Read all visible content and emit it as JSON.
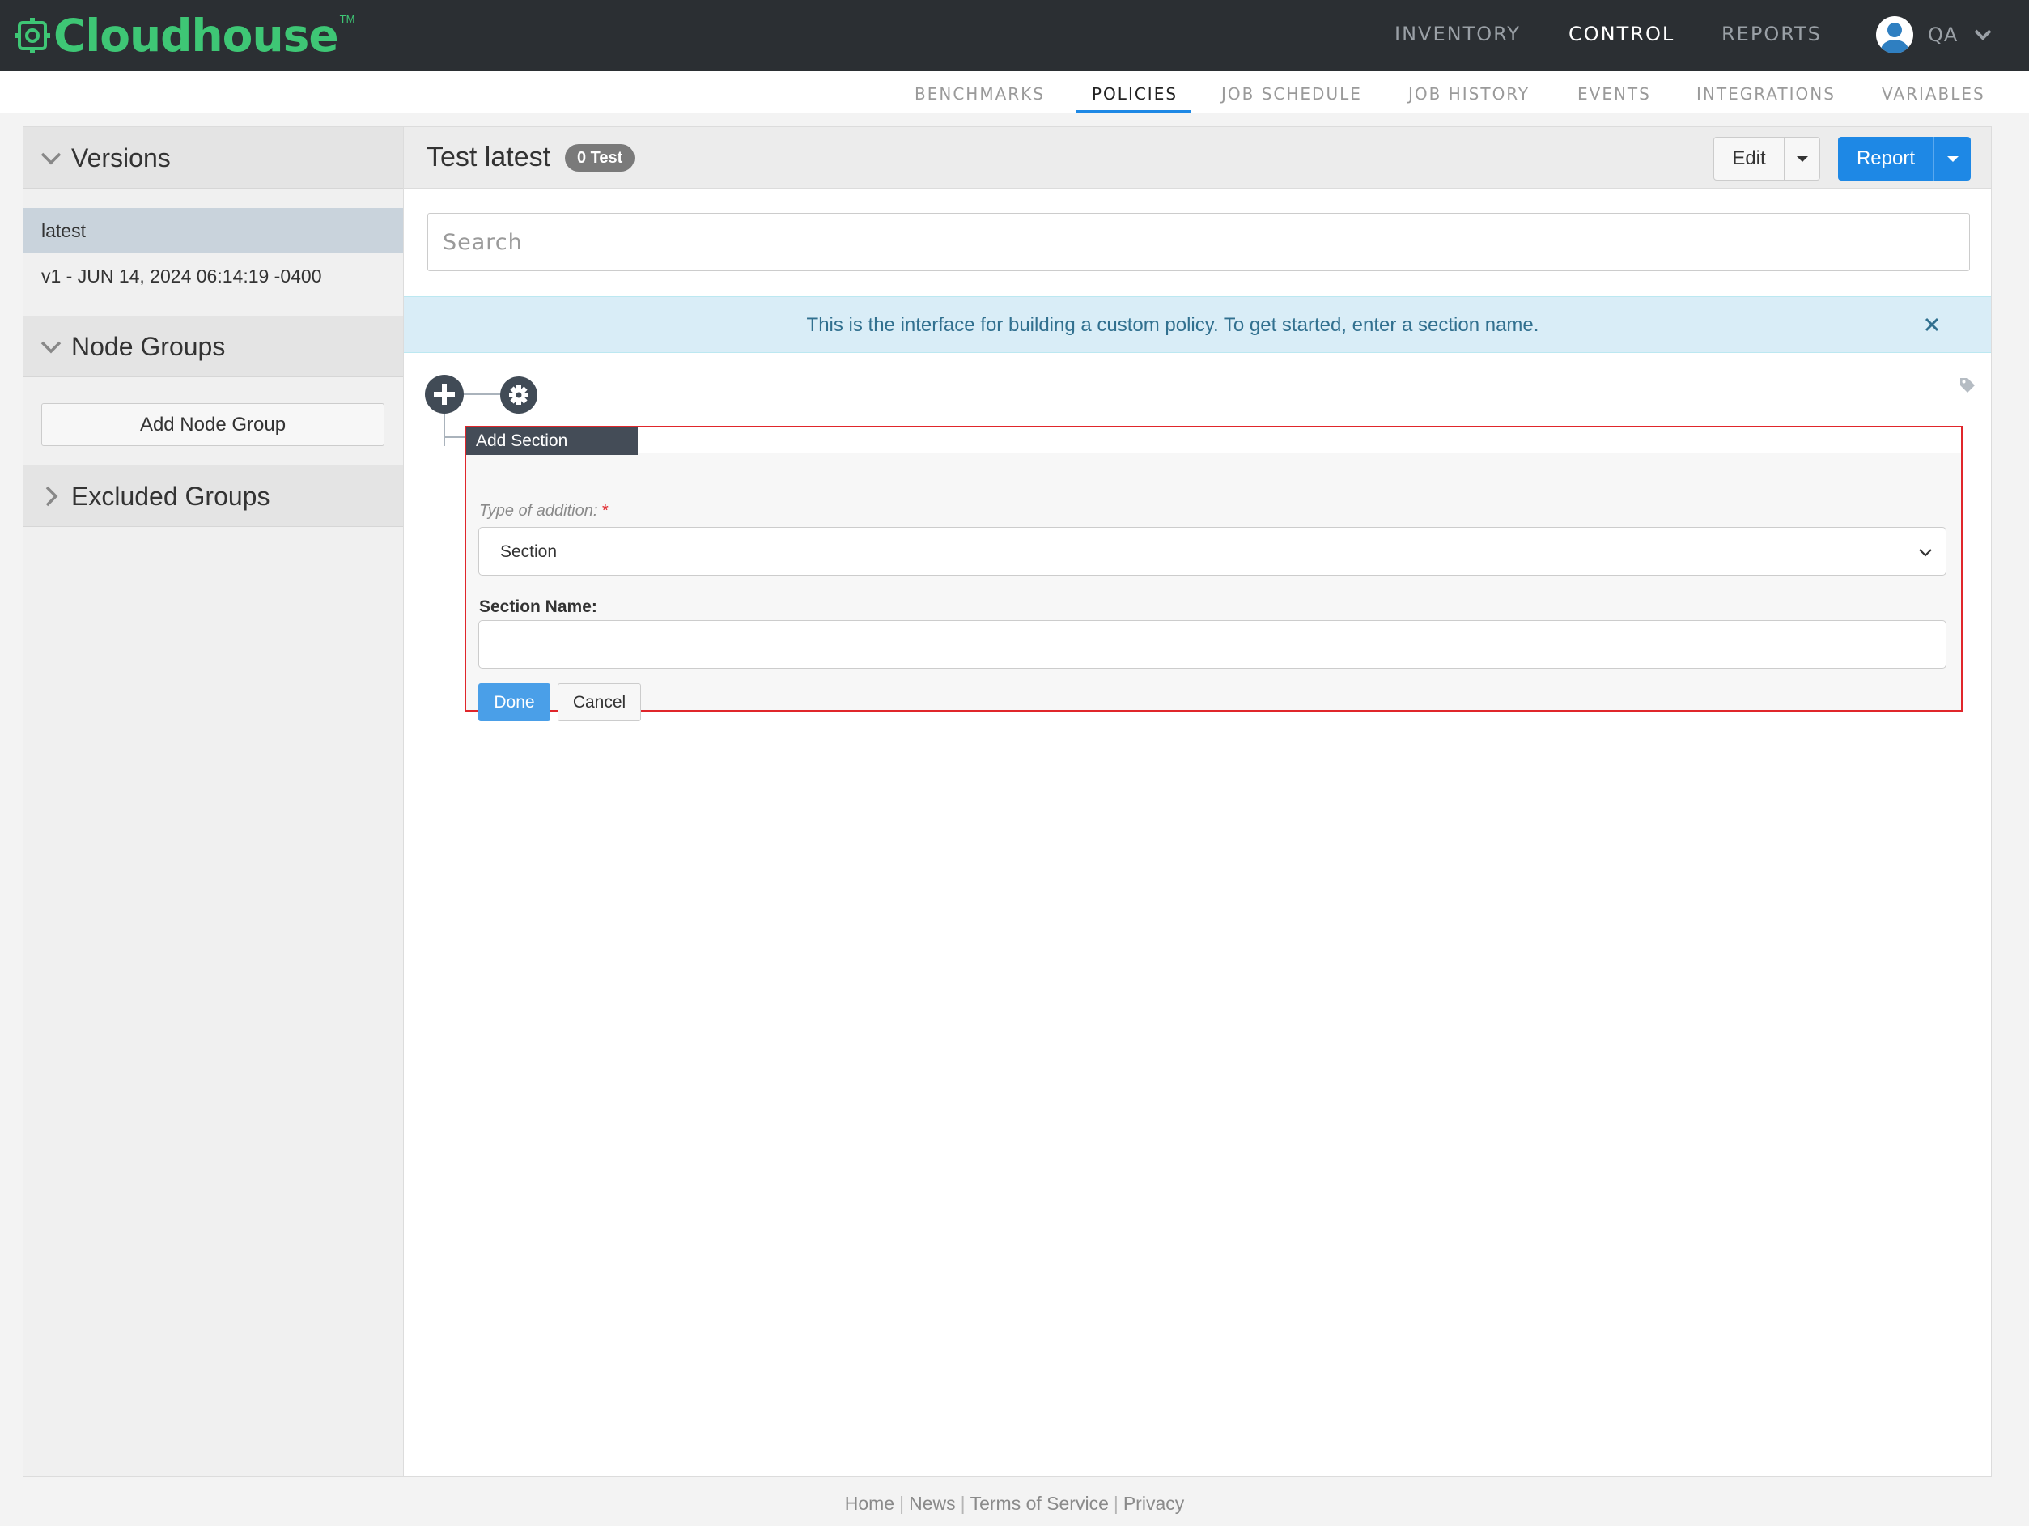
{
  "app": {
    "brand": "Cloudhouse",
    "trademark": "TM"
  },
  "topnav": {
    "items": [
      {
        "label": "INVENTORY",
        "active": false
      },
      {
        "label": "CONTROL",
        "active": true
      },
      {
        "label": "REPORTS",
        "active": false
      }
    ],
    "user_label": "QA"
  },
  "subnav": {
    "items": [
      {
        "label": "BENCHMARKS",
        "active": false
      },
      {
        "label": "POLICIES",
        "active": true
      },
      {
        "label": "JOB SCHEDULE",
        "active": false
      },
      {
        "label": "JOB HISTORY",
        "active": false
      },
      {
        "label": "EVENTS",
        "active": false
      },
      {
        "label": "INTEGRATIONS",
        "active": false
      },
      {
        "label": "VARIABLES",
        "active": false
      }
    ]
  },
  "sidebar": {
    "versions": {
      "title": "Versions",
      "expanded": true,
      "items": [
        {
          "label": "latest",
          "selected": true
        },
        {
          "label": "v1 - JUN 14, 2024 06:14:19 -0400",
          "selected": false
        }
      ]
    },
    "node_groups": {
      "title": "Node Groups",
      "expanded": true,
      "add_button": "Add Node Group"
    },
    "excluded_groups": {
      "title": "Excluded Groups",
      "expanded": false
    }
  },
  "main": {
    "title": "Test latest",
    "badge": "0 Test",
    "edit_button": "Edit",
    "report_button": "Report",
    "search_placeholder": "Search",
    "alert_text": "This is the interface for building a custom policy. To get started, enter a section name.",
    "form": {
      "header": "Add Section",
      "type_label": "Type of addition:",
      "required_mark": "*",
      "type_value": "Section",
      "name_label": "Section Name:",
      "name_value": "",
      "done_button": "Done",
      "cancel_button": "Cancel"
    }
  },
  "footer": {
    "links": [
      "Home",
      "News",
      "Terms of Service",
      "Privacy"
    ],
    "separator": "|"
  },
  "colors": {
    "topbar_bg": "#2b2f33",
    "brand_green": "#3ec675",
    "primary_blue": "#1e88e5",
    "highlight_red": "#e0262b",
    "alert_bg": "#d9edf7",
    "alert_text": "#31708f"
  },
  "icons": {
    "logo": "gear-logo-icon",
    "user": "user-avatar-icon",
    "user_menu": "chevron-down-icon",
    "alert_close": "close-icon",
    "tag": "tag-icon",
    "add": "plus-circle-icon",
    "settings": "gear-icon"
  }
}
